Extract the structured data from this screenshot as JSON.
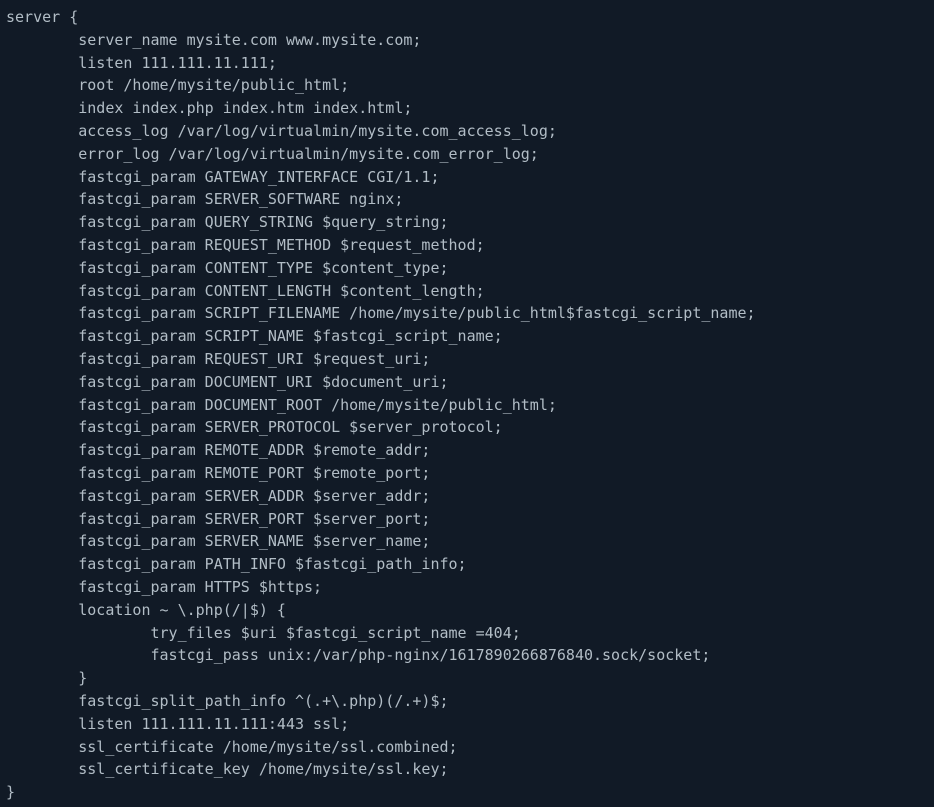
{
  "config": {
    "lines": [
      "server {",
      "        server_name mysite.com www.mysite.com;",
      "        listen 111.111.11.111;",
      "        root /home/mysite/public_html;",
      "        index index.php index.htm index.html;",
      "        access_log /var/log/virtualmin/mysite.com_access_log;",
      "        error_log /var/log/virtualmin/mysite.com_error_log;",
      "        fastcgi_param GATEWAY_INTERFACE CGI/1.1;",
      "        fastcgi_param SERVER_SOFTWARE nginx;",
      "        fastcgi_param QUERY_STRING $query_string;",
      "        fastcgi_param REQUEST_METHOD $request_method;",
      "        fastcgi_param CONTENT_TYPE $content_type;",
      "        fastcgi_param CONTENT_LENGTH $content_length;",
      "        fastcgi_param SCRIPT_FILENAME /home/mysite/public_html$fastcgi_script_name;",
      "        fastcgi_param SCRIPT_NAME $fastcgi_script_name;",
      "        fastcgi_param REQUEST_URI $request_uri;",
      "        fastcgi_param DOCUMENT_URI $document_uri;",
      "        fastcgi_param DOCUMENT_ROOT /home/mysite/public_html;",
      "        fastcgi_param SERVER_PROTOCOL $server_protocol;",
      "        fastcgi_param REMOTE_ADDR $remote_addr;",
      "        fastcgi_param REMOTE_PORT $remote_port;",
      "        fastcgi_param SERVER_ADDR $server_addr;",
      "        fastcgi_param SERVER_PORT $server_port;",
      "        fastcgi_param SERVER_NAME $server_name;",
      "        fastcgi_param PATH_INFO $fastcgi_path_info;",
      "        fastcgi_param HTTPS $https;",
      "        location ~ \\.php(/|$) {",
      "                try_files $uri $fastcgi_script_name =404;",
      "                fastcgi_pass unix:/var/php-nginx/1617890266876840.sock/socket;",
      "        }",
      "        fastcgi_split_path_info ^(.+\\.php)(/.+)$;",
      "        listen 111.111.11.111:443 ssl;",
      "        ssl_certificate /home/mysite/ssl.combined;",
      "        ssl_certificate_key /home/mysite/ssl.key;",
      "}"
    ]
  }
}
